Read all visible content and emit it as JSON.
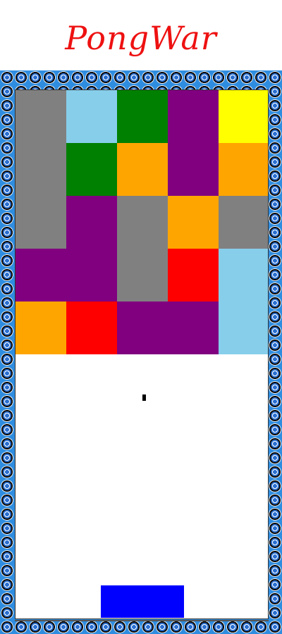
{
  "title": "PongWar",
  "colors": {
    "title": "#ee1111",
    "frame_tile": "#2f8de0",
    "board": "#ffffff",
    "paddle": "#0000ff",
    "ball": "#000000"
  },
  "bricks": [
    {
      "color": "gray"
    },
    {
      "color": "skyblue"
    },
    {
      "color": "green"
    },
    {
      "color": "purple"
    },
    {
      "color": "yellow"
    },
    {
      "color": "green"
    },
    {
      "color": "orange"
    },
    {
      "color": "orange"
    },
    {
      "color": "purple"
    },
    {
      "color": "gray"
    },
    {
      "color": "orange"
    },
    {
      "color": "gray"
    },
    {
      "color": "purple"
    },
    {
      "color": "red"
    },
    {
      "color": "skyblue"
    },
    {
      "color": "orange"
    },
    {
      "color": "red"
    },
    {
      "color": "purple"
    }
  ],
  "palette": {
    "gray": "#808080",
    "skyblue": "#87ceeb",
    "green": "#008000",
    "purple": "#800080",
    "yellow": "#ffff00",
    "orange": "#ffa500",
    "red": "#ff0000"
  }
}
